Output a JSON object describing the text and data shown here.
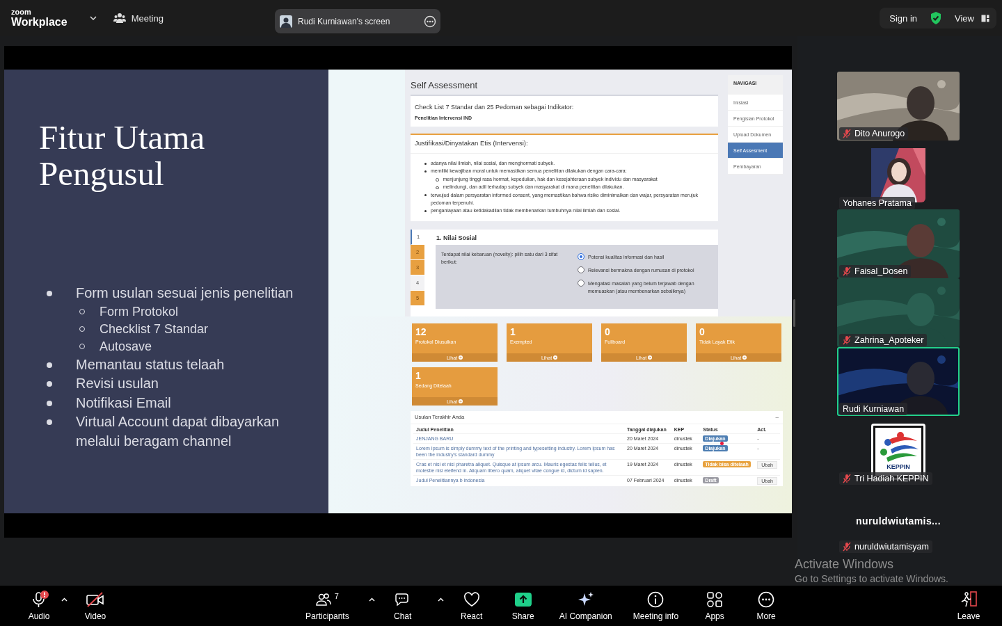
{
  "top_bar": {
    "logo_top": "zoom",
    "logo": "Workplace",
    "meeting": "Meeting",
    "share_label": "Rudi Kurniawan's screen",
    "sign_in": "Sign in",
    "view": "View"
  },
  "slide": {
    "title": "Fitur Utama Pengusul",
    "bullets": [
      {
        "text": "Form usulan sesuai jenis penelitian",
        "children": [
          {
            "text": "Form Protokol"
          },
          {
            "text": "Checklist 7 Standar"
          },
          {
            "text": "Autosave"
          }
        ]
      },
      {
        "text": "Memantau status telaah"
      },
      {
        "text": "Revisi usulan"
      },
      {
        "text": "Notifikasi Email"
      },
      {
        "text": "Virtual Account dapat dibayarkan melalui beragam channel"
      }
    ]
  },
  "app": {
    "heading": "Self Assessment",
    "checklist": {
      "title": "Check List 7 Standar dan 25 Pedoman sebagai Indikator:",
      "subtitle": "Penelitian Intervensi IND"
    },
    "justification": {
      "title": "Justifikasi/Dinyatakan Etis (Intervensi):",
      "items": [
        {
          "text": "adanya nilai ilmiah, nilai sosial, dan menghormati subyek."
        },
        {
          "text": "memiliki kewajiban moral untuk memastikan semua penelitian dilakukan dengan cara-cara:",
          "children": [
            {
              "text": "menjunjung tinggi rasa hormat, kepedulian, hak dan kesejahteraan subyek individu dan masyarakat"
            },
            {
              "text": "melindungi, dan adil terhadap subyek dan masyarakat di mana penelitian dilakukan."
            }
          ]
        },
        {
          "text": "terwujud dalam persyaratan informed consent, yang memastikan bahwa risiko diminimalkan dan wajar, persyaratan merujuk pedoman terpenuhi."
        },
        {
          "text": "penganiayaan atau ketidakadilan tidak membenarkan tumbuhnya nilai ilmiah dan sosial."
        }
      ]
    },
    "question": {
      "steps": [
        {
          "label": "1",
          "selected": true,
          "filled": false
        },
        {
          "label": "2",
          "selected": false,
          "filled": true
        },
        {
          "label": "3",
          "selected": false,
          "filled": true
        },
        {
          "label": "4",
          "selected": false,
          "filled": false
        },
        {
          "label": "5",
          "selected": false,
          "filled": true
        }
      ],
      "title": "1. Nilai Sosial",
      "prompt": "Terdapat nilai kebaruan (novelty): pilih satu dari 3 sifat berikut:",
      "options": [
        {
          "label": "Potensi kualitas informasi dan hasil",
          "selected": true
        },
        {
          "label": "Relevansi bermakna dengan rumusan di protokol",
          "selected": false
        },
        {
          "label": "Mengatasi masalah yang belum terjawab dengan memuaskan (atau membenarkan sebaliknya)",
          "selected": false
        }
      ]
    },
    "nav": {
      "title": "NAVIGASI",
      "items": [
        {
          "label": "Inisiasi",
          "selected": false
        },
        {
          "label": "Pengisian Protokol",
          "selected": false
        },
        {
          "label": "Upload Dokumen",
          "selected": false
        },
        {
          "label": "Self Assesment",
          "selected": true
        },
        {
          "label": "Pembayaran",
          "selected": false
        }
      ]
    },
    "stats": [
      {
        "value": "12",
        "label": "Protokol Diusulkan",
        "link": "Lihat"
      },
      {
        "value": "1",
        "label": "Exempted",
        "link": "Lihat"
      },
      {
        "value": "0",
        "label": "Fullboard",
        "link": "Lihat"
      },
      {
        "value": "0",
        "label": "Tidak Layak Etik",
        "link": "Lihat"
      },
      {
        "value": "1",
        "label": "Sedang Ditelaah",
        "link": "Lihat"
      }
    ],
    "recent": {
      "title": "Usulan Terakhir Anda",
      "collapse": "–",
      "columns": [
        "Judul Penelitian",
        "Tanggal diajukan",
        "KEP",
        "Status",
        "Act."
      ],
      "rows": [
        {
          "title": "JENJANG BARU",
          "date": "20 Maret 2024",
          "kep": "dinustek",
          "status": {
            "label": "Diajukan",
            "color": "#4f7fb3"
          },
          "action": {
            "kind": "text",
            "label": "-"
          }
        },
        {
          "title": "Lorem Ipsum is simply dummy text of the printing and typesetting industry. Lorem Ipsum has been the industry's standard dummy",
          "date": "20 Maret 2024",
          "kep": "dinustek",
          "status": {
            "label": "Diajukan",
            "color": "#4f7fb3"
          },
          "action": {
            "kind": "text",
            "label": "-"
          }
        },
        {
          "title": "Cras et nisi et nisl pharetra aliquet. Quisque at ipsum arcu. Mauris egestas felis tellus, et molestie nisi eleifend in. Aliquam libero quam, aliquet vitae congue id, dictum id sapien.",
          "date": "19 Maret 2024",
          "kep": "dinustek",
          "status": {
            "label": "Tidak bisa ditelaah",
            "color": "#e8a23e"
          },
          "action": {
            "kind": "button",
            "label": "Ubah"
          }
        },
        {
          "title": "Judul Penelitiannya b indonesia",
          "date": "07 Februari 2024",
          "kep": "dinustek",
          "status": {
            "label": "Draft",
            "color": "#9c9ca4"
          },
          "action": {
            "kind": "button",
            "label": "Ubah"
          }
        }
      ]
    }
  },
  "participants": [
    {
      "name": "Dito Anurogo",
      "muted": true,
      "kind": "video",
      "speaking": false
    },
    {
      "name": "Yohanes Pratama",
      "muted": false,
      "kind": "avatar"
    },
    {
      "name": "Faisal_Dosen",
      "muted": true,
      "kind": "video",
      "speaking": false
    },
    {
      "name": "Zahrina_Apoteker",
      "muted": true,
      "kind": "video",
      "speaking": false
    },
    {
      "name": "Rudi Kurniawan",
      "muted": false,
      "kind": "video",
      "speaking": true
    },
    {
      "name": "Tri Hadiah KEPPIN",
      "muted": true,
      "kind": "logo",
      "logo_text": "KEPPIN"
    },
    {
      "name": "nuruldwiutamisyam",
      "muted": true,
      "kind": "name",
      "display_name": "nuruldwiutamis..."
    }
  ],
  "os_notice": {
    "title": "Activate Windows",
    "text": "Go to Settings to activate Windows."
  },
  "toolbar": {
    "audio": {
      "label": "Audio",
      "on": true
    },
    "video": {
      "label": "Video",
      "on": false
    },
    "participants": {
      "label": "Participants",
      "count": "7"
    },
    "chat": {
      "label": "Chat"
    },
    "react": {
      "label": "React"
    },
    "share": {
      "label": "Share"
    },
    "ai": {
      "label": "AI Companion"
    },
    "info": {
      "label": "Meeting info"
    },
    "apps": {
      "label": "Apps"
    },
    "more": {
      "label": "More"
    },
    "leave": {
      "label": "Leave"
    }
  }
}
